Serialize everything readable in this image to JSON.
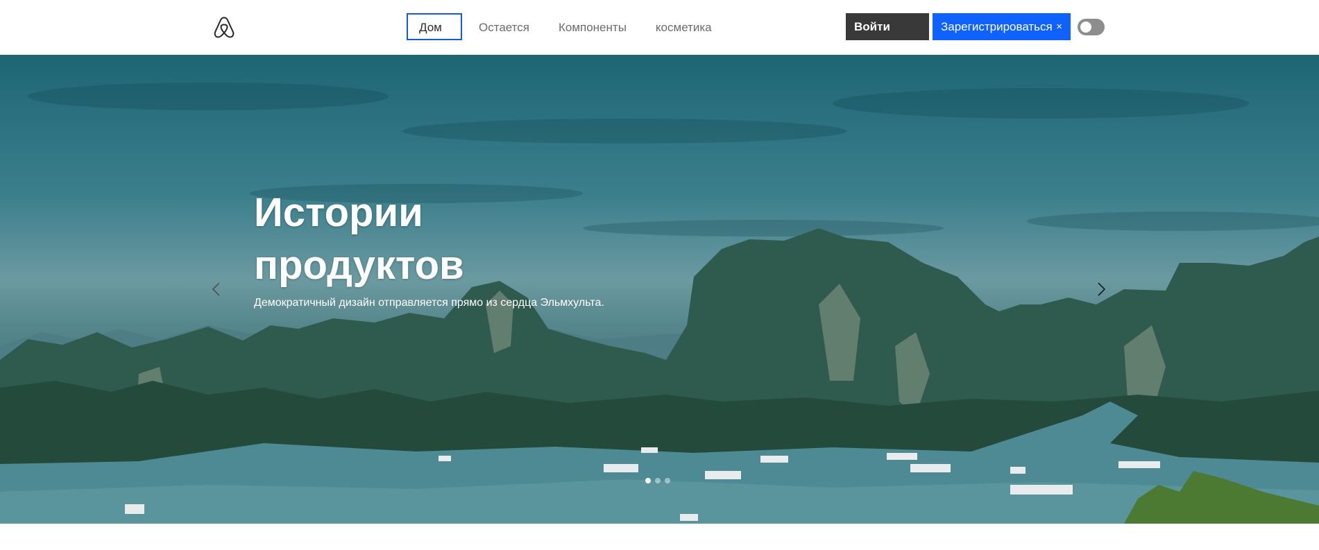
{
  "header": {
    "logo_icon": "airbnb-logo-icon",
    "nav": [
      {
        "label": "Дом",
        "active": true
      },
      {
        "label": "Остается",
        "active": false
      },
      {
        "label": "Компоненты",
        "active": false
      },
      {
        "label": "косметика",
        "active": false
      }
    ],
    "login_label": "Войти",
    "signup_label": "Зарегистрироваться",
    "signup_close": "×",
    "toggle_state": "off"
  },
  "hero": {
    "title": "Истории продуктов",
    "subtitle": "Демократичный дизайн отправляется прямо из сердца Эльмхульта.",
    "prev_icon": "chevron-left-icon",
    "next_icon": "chevron-right-icon",
    "slides": 3,
    "active_slide": 1
  },
  "colors": {
    "accent": "#0f62fe",
    "focus_border": "#1257e6",
    "login_bg": "#393939",
    "toggle_bg": "#8d8d8d"
  }
}
